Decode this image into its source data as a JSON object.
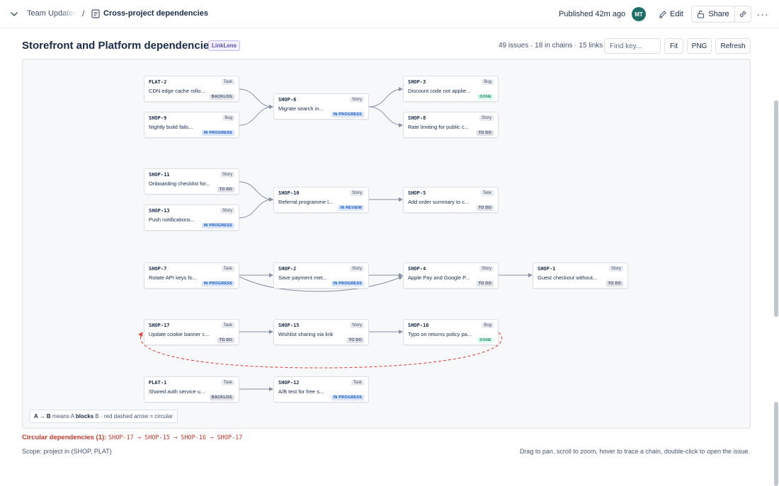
{
  "topbar": {
    "parent_page": "Team Updates",
    "separator": "/",
    "current_page": "Cross-project dependencies",
    "published": "Published 42m ago",
    "avatar_initials": "MT",
    "edit_label": "Edit",
    "share_label": "Share",
    "more_label": "···"
  },
  "header": {
    "title": "Storefront and Platform dependencies",
    "badge": "LinkLens",
    "stats": "49 issues · 18 in chains · 15 links",
    "find_placeholder": "Find key...",
    "fit_label": "Fit",
    "png_label": "PNG",
    "refresh_label": "Refresh"
  },
  "nodes": [
    {
      "key": "PLAT-2",
      "type": "Task",
      "summary": "CDN edge cache rollo...",
      "status": "BACKLOG",
      "status_class": "st-backlog"
    },
    {
      "key": "SHOP-9",
      "type": "Bug",
      "summary": "Nightly build fails...",
      "status": "IN PROGRESS",
      "status_class": "st-inprogress"
    },
    {
      "key": "SHOP-6",
      "type": "Story",
      "summary": "Migrate search in...",
      "status": "IN PROGRESS",
      "status_class": "st-inprogress"
    },
    {
      "key": "SHOP-3",
      "type": "Bug",
      "summary": "Discount code not applie...",
      "status": "DONE",
      "status_class": "st-done"
    },
    {
      "key": "SHOP-8",
      "type": "Story",
      "summary": "Rate limiting for public c...",
      "status": "TO DO",
      "status_class": "st-todo"
    },
    {
      "key": "SHOP-11",
      "type": "Story",
      "summary": "Onboarding checklist for...",
      "status": "TO DO",
      "status_class": "st-todo"
    },
    {
      "key": "SHOP-13",
      "type": "Story",
      "summary": "Push notifications...",
      "status": "IN PROGRESS",
      "status_class": "st-inprogress"
    },
    {
      "key": "SHOP-10",
      "type": "Story",
      "summary": "Referral programme l...",
      "status": "IN REVIEW",
      "status_class": "st-inreview"
    },
    {
      "key": "SHOP-5",
      "type": "Task",
      "summary": "Add order summary to c...",
      "status": "TO DO",
      "status_class": "st-todo"
    },
    {
      "key": "SHOP-7",
      "type": "Task",
      "summary": "Rotate API keys fo...",
      "status": "IN PROGRESS",
      "status_class": "st-inprogress"
    },
    {
      "key": "SHOP-2",
      "type": "Story",
      "summary": "Save payment met...",
      "status": "IN PROGRESS",
      "status_class": "st-inprogress"
    },
    {
      "key": "SHOP-4",
      "type": "Story",
      "summary": "Apple Pay and Google P...",
      "status": "TO DO",
      "status_class": "st-todo"
    },
    {
      "key": "SHOP-1",
      "type": "Story",
      "summary": "Guest checkout without...",
      "status": "TO DO",
      "status_class": "st-todo"
    },
    {
      "key": "SHOP-17",
      "type": "Task",
      "summary": "Update cookie banner c...",
      "status": "TO DO",
      "status_class": "st-todo"
    },
    {
      "key": "SHOP-15",
      "type": "Story",
      "summary": "Wishlist sharing via link",
      "status": "TO DO",
      "status_class": "st-todo"
    },
    {
      "key": "SHOP-16",
      "type": "Bug",
      "summary": "Typo on returns policy pa...",
      "status": "DONE",
      "status_class": "st-done"
    },
    {
      "key": "PLAT-1",
      "type": "Task",
      "summary": "Shared auth service u...",
      "status": "BACKLOG",
      "status_class": "st-backlog"
    },
    {
      "key": "SHOP-12",
      "type": "Task",
      "summary": "A/B test for free s...",
      "status": "IN PROGRESS",
      "status_class": "st-inprogress"
    }
  ],
  "legend": {
    "a_to_b": "A → B",
    "means": " means A ",
    "blocks": "blocks",
    "rest": " B · red dashed arrow = circular"
  },
  "footer": {
    "circular_label": "Circular dependencies (1):",
    "circular_chain": "SHOP-17 → SHOP-15 → SHOP-16 → SHOP-17",
    "scope": "Scope: project in (SHOP, PLAT)",
    "help": "Drag to pan, scroll to zoom, hover to trace a chain, double-click to open the issue."
  },
  "colors": {
    "edge": "#8590a2",
    "circular": "#e2483d",
    "status_done": "#1f845a",
    "status_in_progress": "#0c55cf"
  }
}
